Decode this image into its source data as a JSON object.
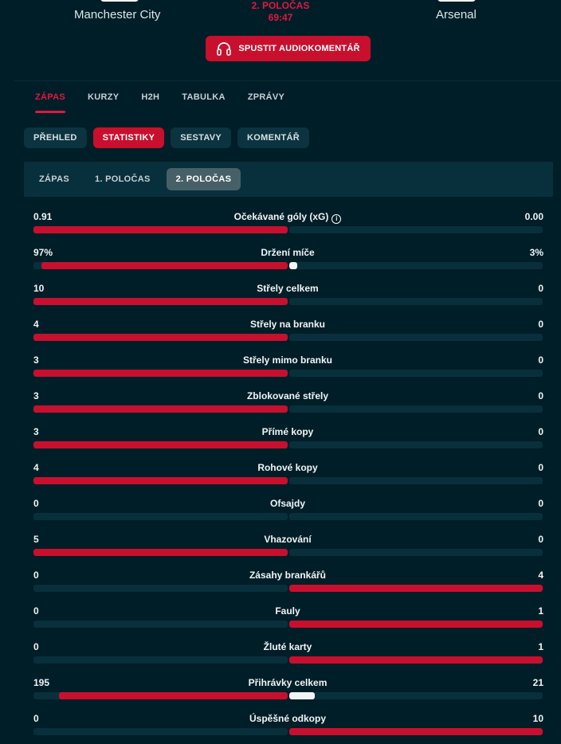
{
  "header": {
    "home_team": "Manchester City",
    "away_team": "Arsenal",
    "period": "2. POLOČAS",
    "time": "69:47",
    "audio_button": "SPUSTIT AUDIOKOMENTÁŘ"
  },
  "main_tabs": [
    "ZÁPAS",
    "KURZY",
    "H2H",
    "TABULKA",
    "ZPRÁVY"
  ],
  "main_tab_active": "ZÁPAS",
  "sub_tabs": [
    "PŘEHLED",
    "STATISTIKY",
    "SESTAVY",
    "KOMENTÁŘ"
  ],
  "sub_tab_active": "STATISTIKY",
  "period_tabs": [
    "ZÁPAS",
    "1. POLOČAS",
    "2. POLOČAS"
  ],
  "period_tab_active": "2. POLOČAS",
  "colors": {
    "accent": "#c8102e",
    "background": "#001e28",
    "bar_track": "#08303c"
  },
  "stats": [
    {
      "label": "Očekávané góly (xG)",
      "home": "0.91",
      "away": "0.00",
      "home_share": 1.0,
      "away_share": 0.0,
      "info_icon": true
    },
    {
      "label": "Držení míče",
      "home": "97%",
      "away": "3%",
      "home_share": 0.97,
      "away_share": 0.03
    },
    {
      "label": "Střely celkem",
      "home": "10",
      "away": "0",
      "home_share": 1.0,
      "away_share": 0.0
    },
    {
      "label": "Střely na branku",
      "home": "4",
      "away": "0",
      "home_share": 1.0,
      "away_share": 0.0
    },
    {
      "label": "Střely mimo branku",
      "home": "3",
      "away": "0",
      "home_share": 1.0,
      "away_share": 0.0
    },
    {
      "label": "Zblokované střely",
      "home": "3",
      "away": "0",
      "home_share": 1.0,
      "away_share": 0.0
    },
    {
      "label": "Přímé kopy",
      "home": "3",
      "away": "0",
      "home_share": 1.0,
      "away_share": 0.0
    },
    {
      "label": "Rohové kopy",
      "home": "4",
      "away": "0",
      "home_share": 1.0,
      "away_share": 0.0
    },
    {
      "label": "Ofsajdy",
      "home": "0",
      "away": "0",
      "home_share": 0.0,
      "away_share": 0.0
    },
    {
      "label": "Vhazování",
      "home": "5",
      "away": "0",
      "home_share": 1.0,
      "away_share": 0.0
    },
    {
      "label": "Zásahy brankářů",
      "home": "0",
      "away": "4",
      "home_share": 0.0,
      "away_share": 1.0
    },
    {
      "label": "Fauly",
      "home": "0",
      "away": "1",
      "home_share": 0.0,
      "away_share": 1.0
    },
    {
      "label": "Žluté karty",
      "home": "0",
      "away": "1",
      "home_share": 0.0,
      "away_share": 1.0
    },
    {
      "label": "Přihrávky celkem",
      "home": "195",
      "away": "21",
      "home_share": 0.9,
      "away_share": 0.1
    },
    {
      "label": "Úspěšné odkopy",
      "home": "0",
      "away": "10",
      "home_share": 0.0,
      "away_share": 1.0
    }
  ]
}
